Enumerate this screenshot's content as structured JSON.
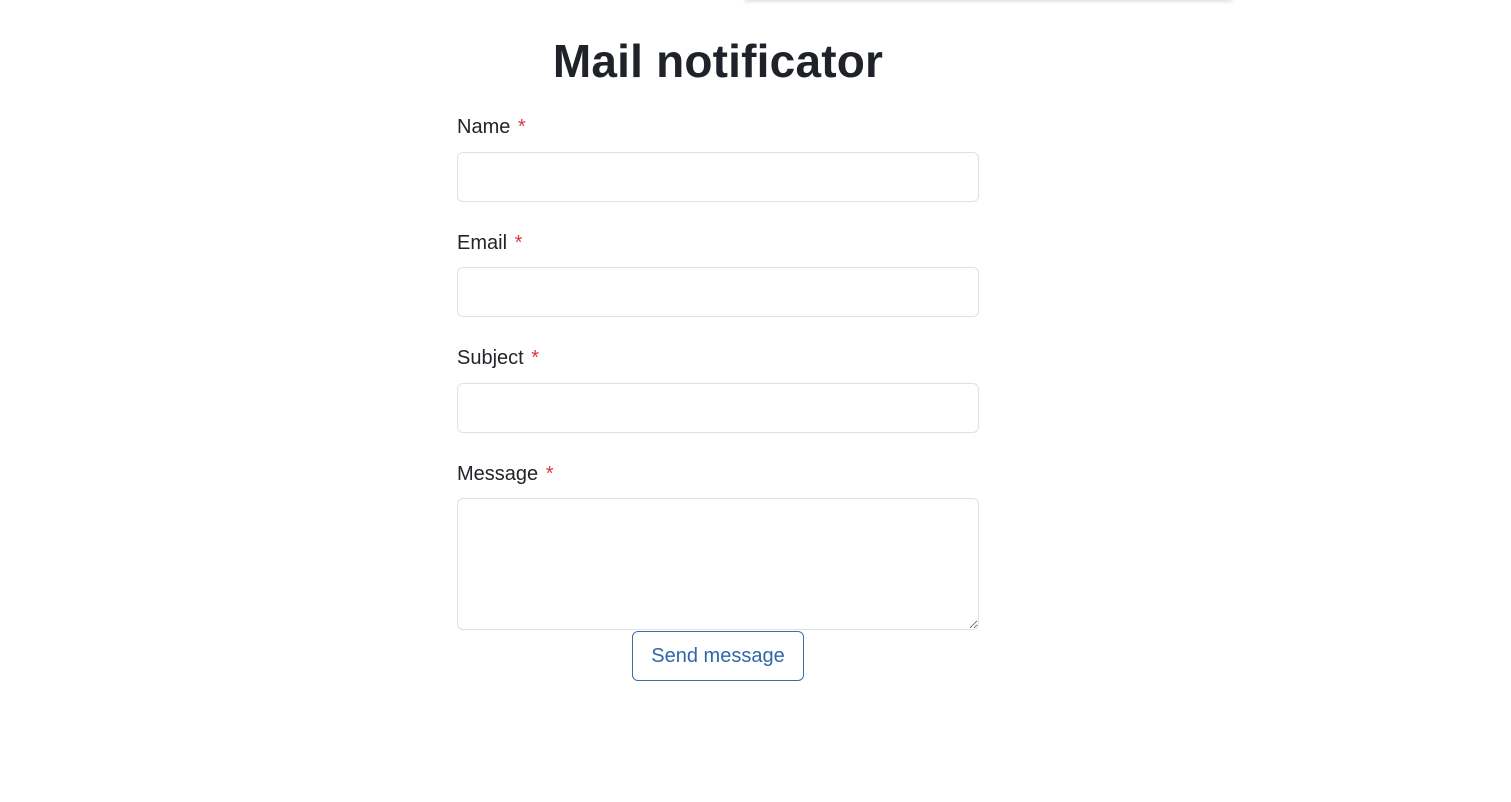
{
  "page": {
    "title": "Mail notificator"
  },
  "form": {
    "required_marker": "*",
    "fields": [
      {
        "label": "Name",
        "value": "",
        "placeholder": ""
      },
      {
        "label": "Email",
        "value": "",
        "placeholder": ""
      },
      {
        "label": "Subject",
        "value": "",
        "placeholder": ""
      },
      {
        "label": "Message",
        "value": "",
        "placeholder": ""
      }
    ],
    "submit_label": "Send message"
  },
  "colors": {
    "required": "#dc3545",
    "button_text": "#2f67a8",
    "button_border": "#3b6ea8",
    "input_border": "#dee2e6",
    "title": "#1f2329"
  }
}
